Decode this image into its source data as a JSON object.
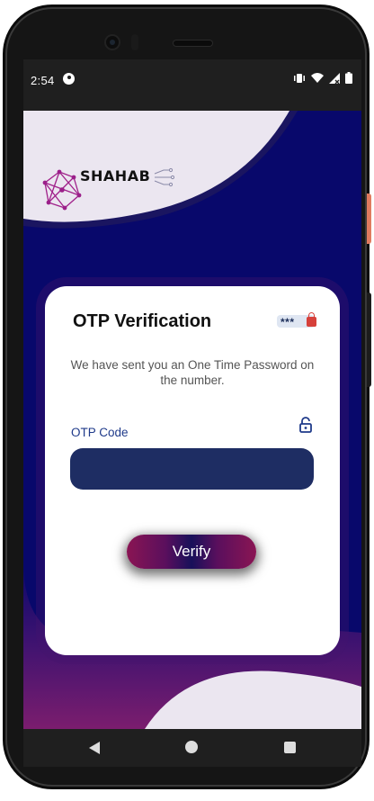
{
  "status_bar": {
    "time": "2:54"
  },
  "brand": {
    "name": "SHAHAB"
  },
  "card": {
    "title": "OTP Verification",
    "badge_text": "***",
    "subtitle": "We have sent you an One Time Password on the number.",
    "otp_label": "OTP Code",
    "otp_value": "",
    "verify_label": "Verify"
  },
  "colors": {
    "background_navy": "#08086b",
    "input_fill": "#1e2d63",
    "label_blue": "#1f3a8a",
    "button_magenta": "#8a1553",
    "card_white": "#ffffff",
    "wave_light": "#ebe6f0"
  },
  "icons": [
    "battery-icon",
    "wifi-icon",
    "signal-icon",
    "vibrate-icon",
    "lock-icon",
    "back-icon",
    "home-icon",
    "recents-icon"
  ]
}
